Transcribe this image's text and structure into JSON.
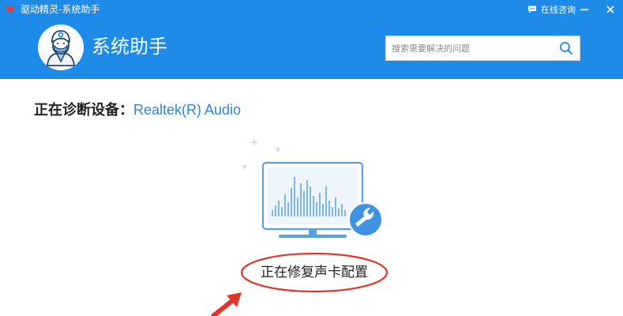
{
  "window": {
    "app_title": "驱动精灵-系统助手",
    "consult_label": "在线咨询"
  },
  "header": {
    "title": "系统助手",
    "search": {
      "placeholder": "搜索需要解决的问题",
      "value": ""
    }
  },
  "diagnosis": {
    "label": "正在诊断设备：",
    "device": "Realtek(R) Audio"
  },
  "status": {
    "text": "正在修复声卡配置"
  },
  "icons": [
    "app-logo-icon",
    "chat-icon",
    "minimize-icon",
    "close-icon",
    "doctor-avatar-icon",
    "search-icon",
    "monitor-icon",
    "wrench-icon",
    "arrow-icon"
  ],
  "colors": {
    "header_bg": "#1e8be8",
    "accent_blue": "#2b86d9",
    "highlight_red": "#e0352b",
    "illustration_blue": "#4a9be8"
  }
}
